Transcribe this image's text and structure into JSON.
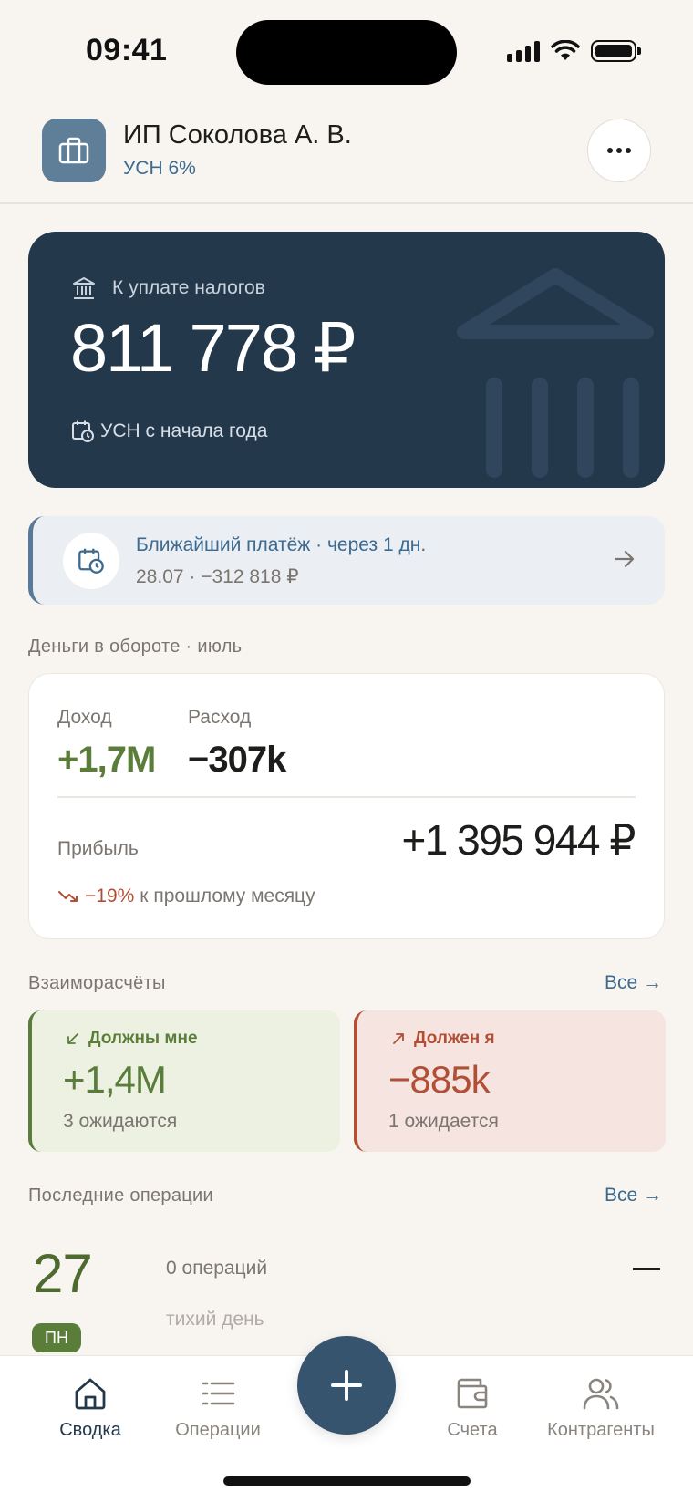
{
  "status_bar": {
    "time": "09:41"
  },
  "header": {
    "org_name": "ИП Соколова А. В.",
    "tax_regime": "УСН 6%",
    "org_icon": "briefcase-icon",
    "more_icon": "more-horizontal-icon"
  },
  "tax_card": {
    "label": "К уплате налогов",
    "amount": "811 778 ₽",
    "subtitle": "УСН с начала года",
    "background": "#24384c"
  },
  "next_payment": {
    "title": "Ближайший платёж · через 1 дн.",
    "details": "28.07 · −312 818 ₽"
  },
  "money": {
    "section_title": "Деньги в обороте · июль",
    "income_label": "Доход",
    "income_value": "+1,7M",
    "expense_label": "Расход",
    "expense_value": "−307k",
    "profit_label": "Прибыль",
    "profit_value": "+1 395 944 ₽",
    "trend_pct": "−19%",
    "trend_text": "к прошлому месяцу"
  },
  "settlements": {
    "section_title": "Взаиморасчёты",
    "see_all": "Все →",
    "owed_to_me": {
      "title": "Должны мне",
      "value": "+1,4M",
      "sub": "3 ожидаются",
      "color": "#5b7d3a"
    },
    "i_owe": {
      "title": "Должен я",
      "value": "−885k",
      "sub": "1 ожидается",
      "color": "#b14e36"
    }
  },
  "recent_ops": {
    "section_title": "Последние операции",
    "see_all": "Все →",
    "day": "27",
    "weekday": "ПН",
    "count": "0 операций",
    "note": "тихий день",
    "amount": "—"
  },
  "tabbar": {
    "tabs": [
      {
        "label": "Сводка",
        "icon": "home-icon",
        "active": true
      },
      {
        "label": "Операции",
        "icon": "list-icon",
        "active": false
      },
      {
        "label": "Счета",
        "icon": "wallet-icon",
        "active": false
      },
      {
        "label": "Контрагенты",
        "icon": "users-icon",
        "active": false
      }
    ],
    "fab_icon": "plus-icon"
  }
}
